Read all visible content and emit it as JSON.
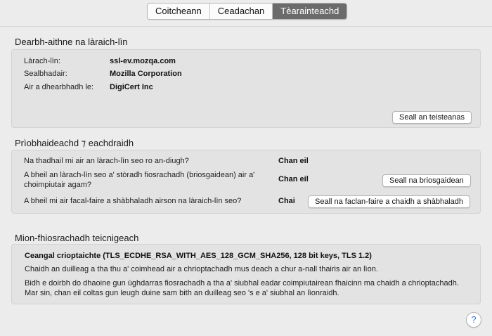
{
  "tabs": [
    {
      "label": "Coitcheann",
      "active": false
    },
    {
      "label": "Ceadachan",
      "active": false
    },
    {
      "label": "Tèarainteachd",
      "active": true
    }
  ],
  "identity": {
    "title": "Dearbh-aithne na làraich-lìn",
    "website_label": "Làrach-lìn:",
    "website_value": "ssl-ev.mozqa.com",
    "owner_label": "Sealbhadair:",
    "owner_value": "Mozilla Corporation",
    "verifier_label": "Air a dhearbhadh le:",
    "verifier_value": "DigiCert Inc",
    "view_cert_button": "Seall an teisteanas"
  },
  "privacy": {
    "title": "Prìobhaideachd ⁊ eachdraidh",
    "q1": "Na thadhail mi air an làrach-lìn seo ro an-diugh?",
    "a1": "Chan eil",
    "q2": "A bheil an làrach-lìn seo a' stòradh fiosrachadh (briosgaidean) air a' choimpiutair agam?",
    "a2": "Chan eil",
    "cookies_button": "Seall na briosgaidean",
    "q3": "A bheil mi air facal-faire a shàbhaladh airson na làraich-lìn seo?",
    "a3": "Chai",
    "passwords_button": "Seall na faclan-faire a chaidh a shàbhaladh"
  },
  "technical": {
    "title": "Mion-fhiosrachadh teicnigeach",
    "connection": "Ceangal crioptaichte (TLS_ECDHE_RSA_WITH_AES_128_GCM_SHA256, 128 bit keys, TLS 1.2)",
    "para1": "Chaidh an duilleag a tha thu a' coimhead air a chrioptachadh mus deach a chur a-nall thairis air an lìon.",
    "para2": "Bidh e doirbh do dhaoine gun ùghdarras fiosrachadh a tha a' siubhal eadar coimpiutairean fhaicinn ma chaidh a chrioptachadh. Mar sin, chan eil coltas gun leugh duine sam bith an duilleag seo 's e a' siubhal an lìonraidh."
  },
  "help_icon": "?"
}
